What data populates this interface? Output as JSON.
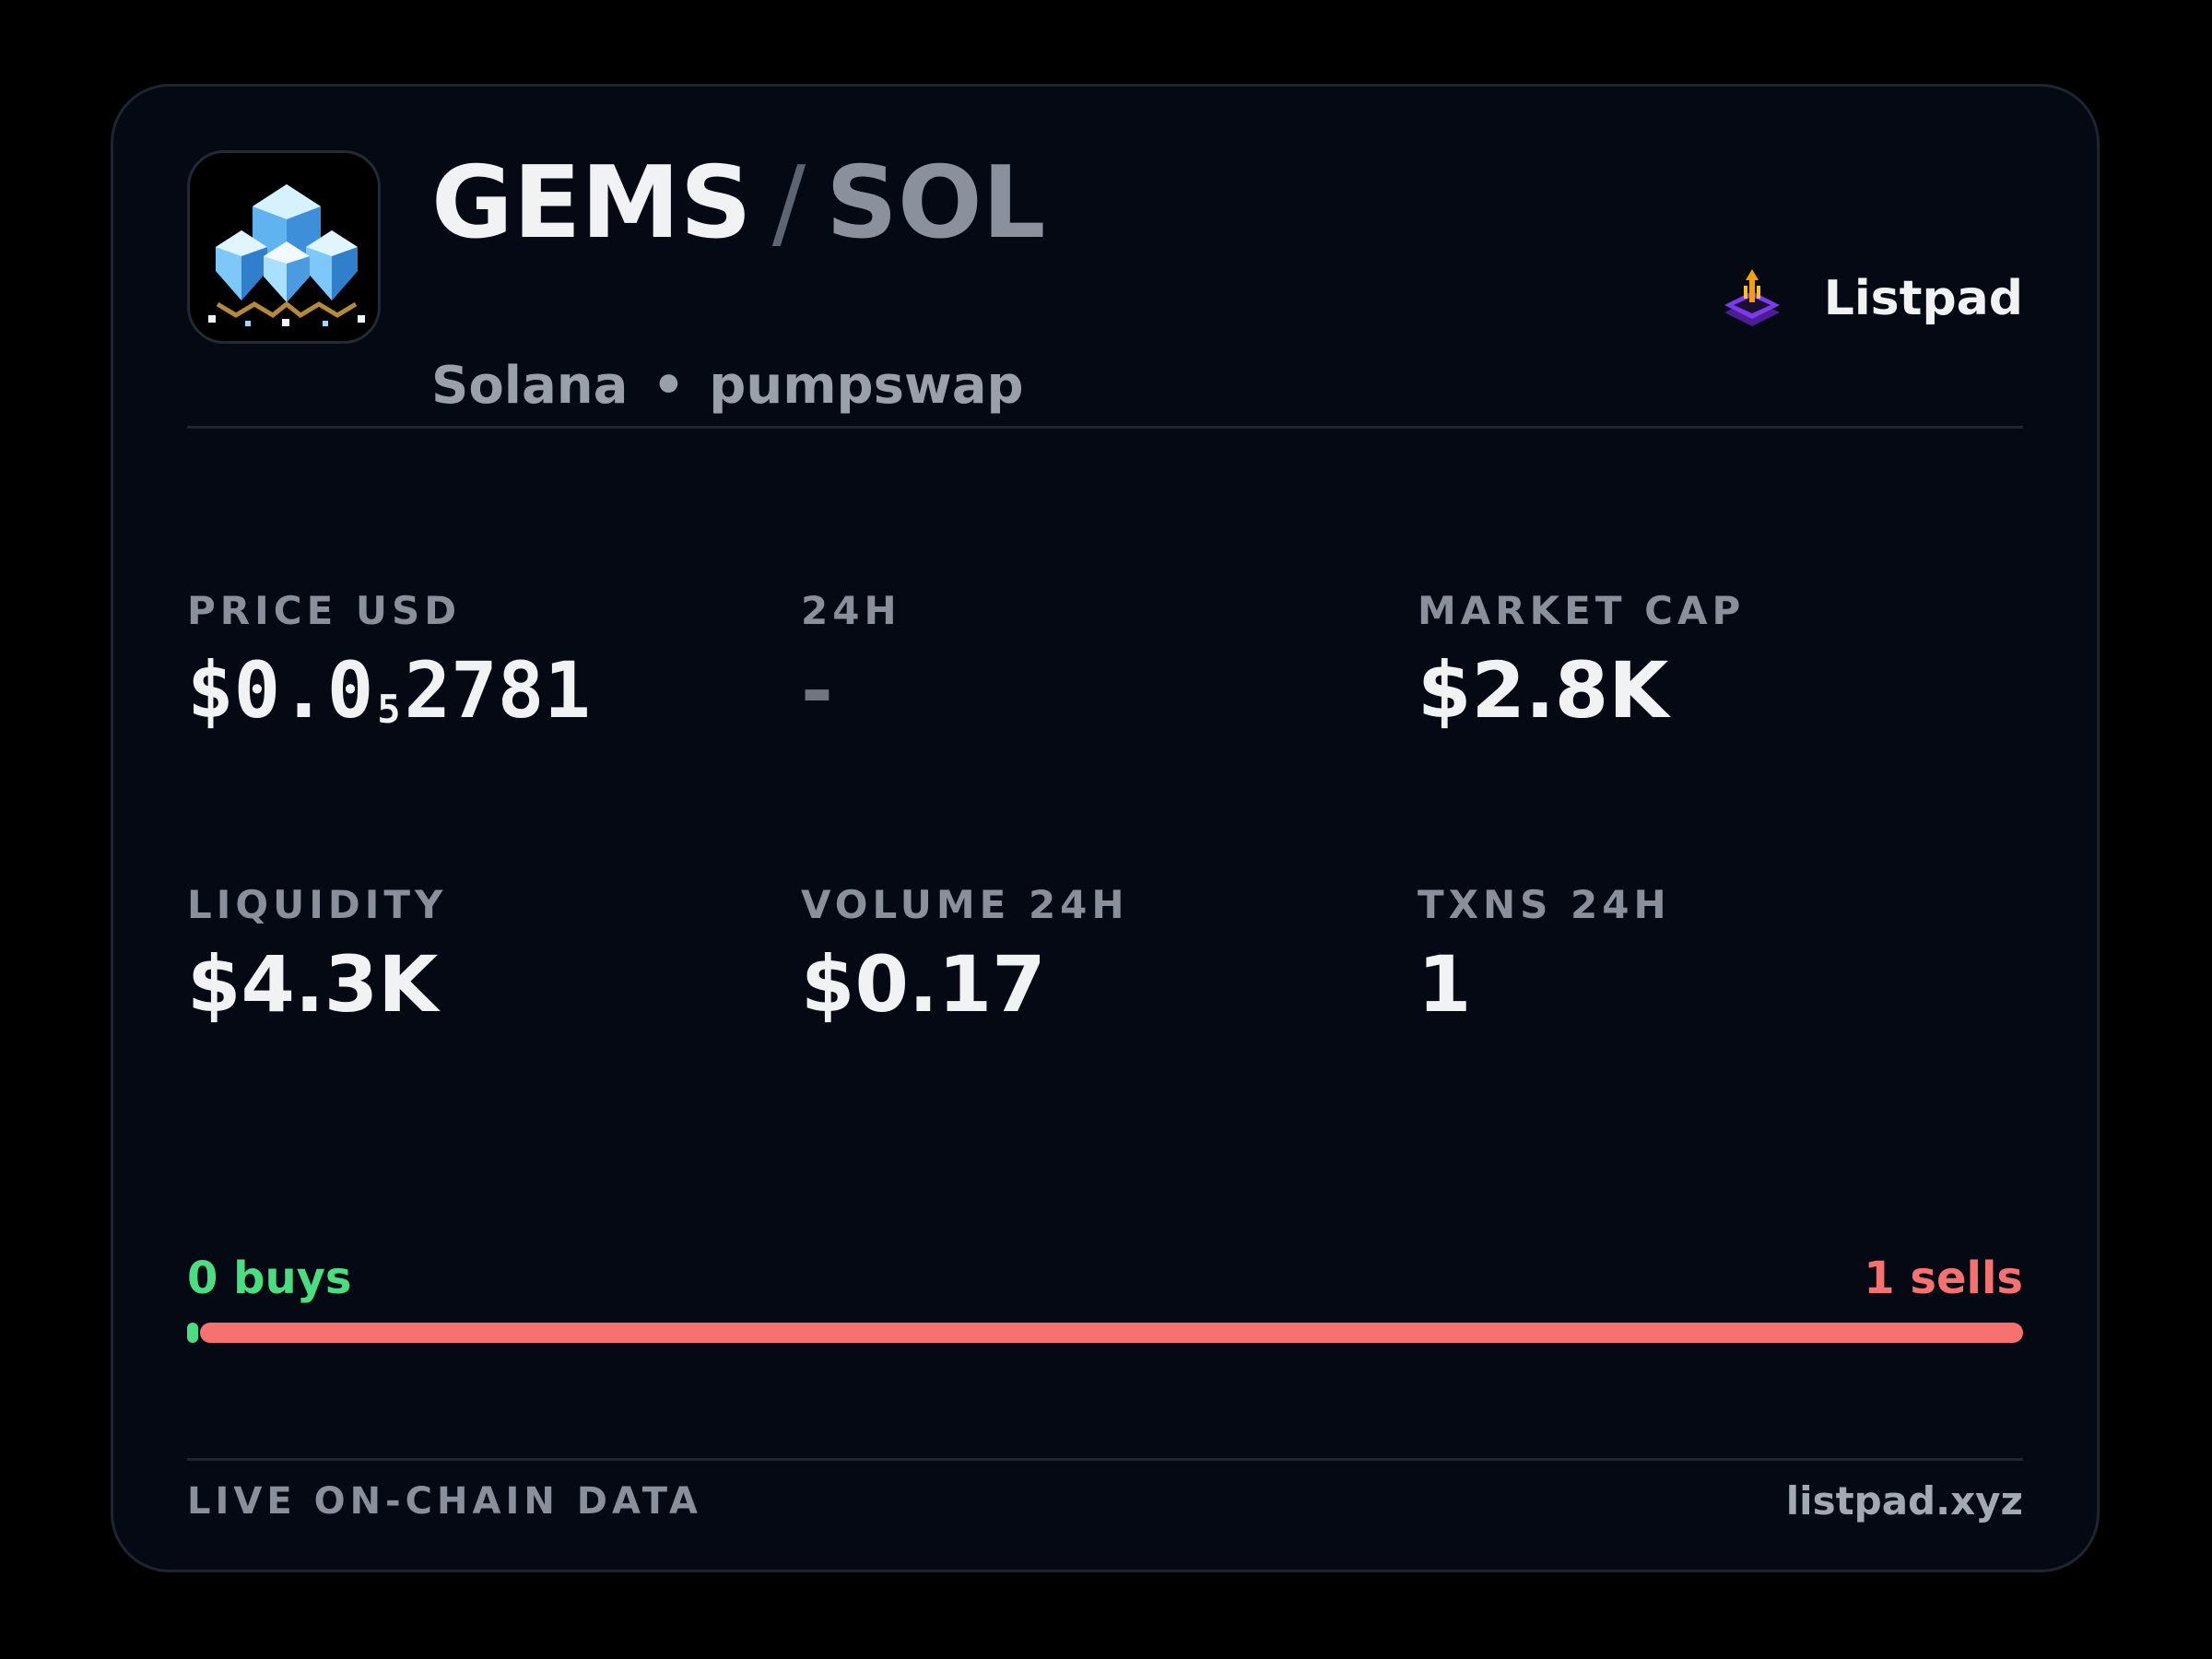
{
  "token": {
    "base": "GEMS",
    "separator": "/",
    "quote": "SOL",
    "chain": "Solana",
    "dot": "•",
    "dex": "pumpswap",
    "logo_icon": "diamond-gems-icon"
  },
  "brand": {
    "name": "Listpad",
    "icon": "listpad-logo-icon"
  },
  "stats": {
    "price_usd": {
      "label": "PRICE USD",
      "prefix": "$0.0",
      "zero_count": "5",
      "digits": "2781"
    },
    "change_24h": {
      "label": "24H",
      "value": "-"
    },
    "market_cap": {
      "label": "MARKET CAP",
      "value": "$2.8K"
    },
    "liquidity": {
      "label": "LIQUIDITY",
      "value": "$4.3K"
    },
    "volume_24h": {
      "label": "VOLUME 24H",
      "value": "$0.17"
    },
    "txns_24h": {
      "label": "TXNS 24H",
      "value": "1"
    }
  },
  "trades": {
    "buys_label": "0 buys",
    "sells_label": "1 sells",
    "buys": 0,
    "sells": 1
  },
  "footer": {
    "left": "LIVE ON-CHAIN DATA",
    "right": "listpad.xyz"
  },
  "colors": {
    "buy": "#4ade80",
    "sell": "#f87171",
    "card_bg": "#050914",
    "accent_brand": "#7c3aed"
  }
}
